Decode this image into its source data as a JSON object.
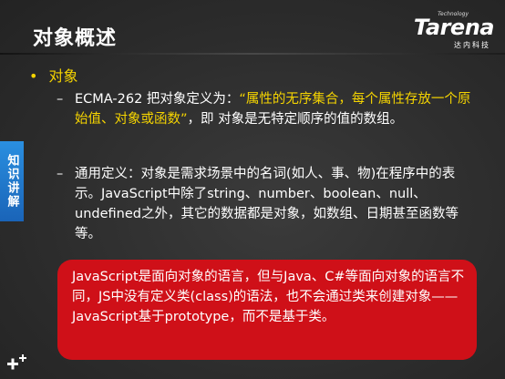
{
  "slide": {
    "title": "对象概述",
    "logo": {
      "brand": "Tarena",
      "tagline": "Technology",
      "cn": "达内科技"
    },
    "side_tab": "知识讲解",
    "main_bullet": "对象",
    "item1": {
      "prefix": "ECMA-262 把对象定义为：",
      "quote": "“属性的无序集合，每个属性存放一个原始值、对象或函数”",
      "suffix": "，即 对象是无特定顺序的值的数组。"
    },
    "item2": "通用定义：对象是需求场景中的名词(如人、事、物)在程序中的表示。JavaScript中除了string、number、boolean、null、undefined之外，其它的数据都是对象，如数组、日期甚至函数等等。",
    "callout": "JavaScript是面向对象的语言，但与Java、C#等面向对象的语言不同，JS中没有定义类(class)的语法，也不会通过类来创建对象——JavaScript基于prototype，而不是基于类。"
  },
  "colors": {
    "accent_yellow": "#f5d400",
    "callout_red": "#cf1018",
    "tab_blue": "#1a64b8"
  }
}
